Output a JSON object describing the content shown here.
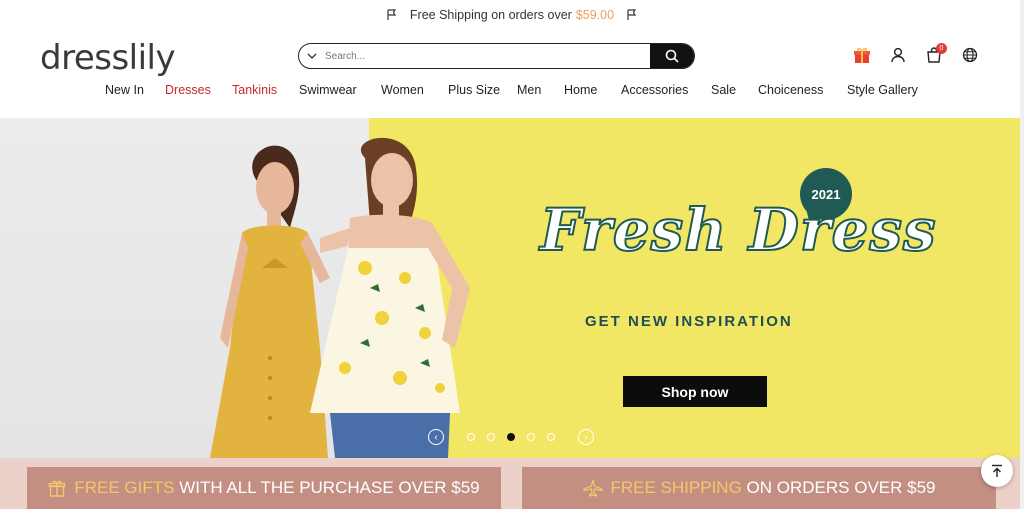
{
  "topbar": {
    "text": "Free Shipping on orders over",
    "amount": "$59.00"
  },
  "header": {
    "logo": "dresslily",
    "search_placeholder": "Search...",
    "cart_count": "0"
  },
  "nav": {
    "items": [
      {
        "label": "New In"
      },
      {
        "label": "Dresses"
      },
      {
        "label": "Tankinis"
      },
      {
        "label": "Swimwear"
      },
      {
        "label": "Women"
      },
      {
        "label": "Plus Size"
      },
      {
        "label": "Men"
      },
      {
        "label": "Home"
      },
      {
        "label": "Accessories"
      },
      {
        "label": "Sale"
      },
      {
        "label": "Choiceness"
      },
      {
        "label": "Style Gallery"
      }
    ]
  },
  "hero": {
    "year_badge": "2021",
    "headline": "Fresh Dress",
    "subheadline": "GET NEW INSPIRATION",
    "cta": "Shop now",
    "slide_count": 5,
    "active_slide": 3
  },
  "promo": {
    "left": {
      "highlight": "FREE GIFTS",
      "rest": "WITH ALL THE PURCHASE OVER $59",
      "icon": "gift-icon"
    },
    "right": {
      "highlight": "FREE SHIPPING",
      "rest": "ON ORDERS OVER $59",
      "icon": "plane-icon"
    }
  },
  "colors": {
    "brand_red": "#c8272f",
    "hero_yellow": "#f2e764",
    "accent_teal": "#1f5a55",
    "promo_bg": "#ecd0ca",
    "promo_card": "#c48f83",
    "promo_highlight": "#f6c66b"
  }
}
